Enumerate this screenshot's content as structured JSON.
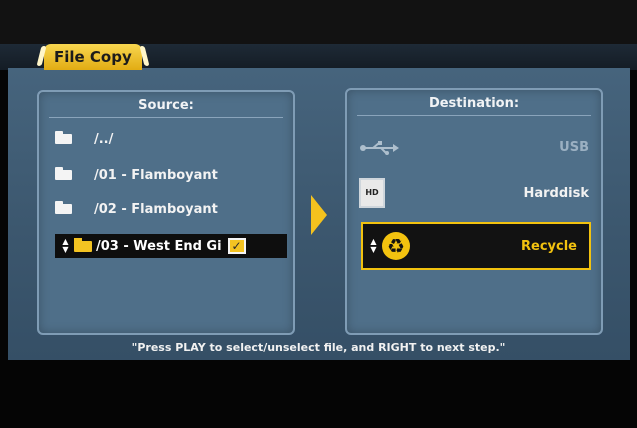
{
  "window": {
    "title": "File Copy"
  },
  "source": {
    "title": "Source:",
    "items": [
      {
        "label": "/../"
      },
      {
        "label": "/01 - Flamboyant"
      },
      {
        "label": "/02 - Flamboyant"
      }
    ],
    "selected": {
      "label": "/03 - West End Gi",
      "checked": true,
      "check_glyph": "✓"
    }
  },
  "destination": {
    "title": "Destination:",
    "items": [
      {
        "label": "USB",
        "icon": "usb-icon",
        "enabled": false
      },
      {
        "label": "Harddisk",
        "icon": "hdd-icon",
        "icon_text": "HD",
        "enabled": true
      },
      {
        "label": "Recycle",
        "icon": "recycle-icon",
        "icon_text": "♻",
        "enabled": true,
        "selected": true
      }
    ]
  },
  "hint": "\"Press PLAY to select/unselect file, and RIGHT to next step.\"",
  "colors": {
    "accent": "#f2c20f",
    "panel": "#3f5a72",
    "box": "#4f6f89",
    "disabled_text": "#9bb0c2"
  }
}
